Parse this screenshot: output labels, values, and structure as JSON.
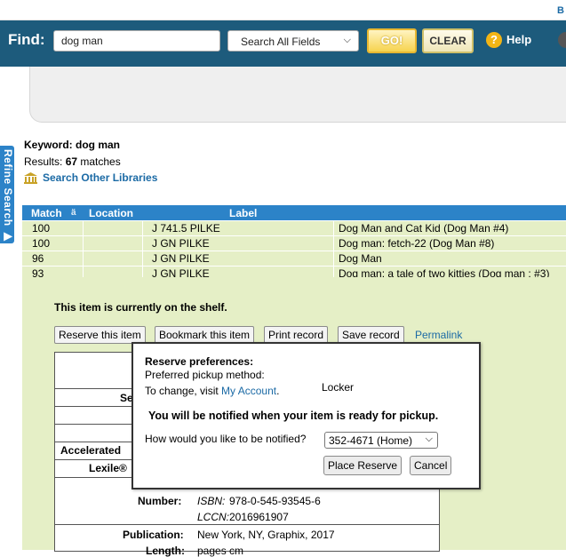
{
  "header": {
    "corner_letter": "B",
    "find_label": "Find:",
    "search_value": "dog man",
    "field_select": "Search All Fields",
    "go_label": "GO!",
    "clear_label": "CLEAR",
    "help_label": "Help"
  },
  "sidebar": {
    "refine_label": "Refine Search ▶"
  },
  "results": {
    "keyword_label": "Keyword: dog man",
    "results_prefix": "Results: ",
    "results_count": "67",
    "results_suffix": " matches",
    "other_libraries": "Search Other Libraries"
  },
  "table": {
    "columns": [
      "Match",
      "Location",
      "Label"
    ],
    "sort_indicator": "ä",
    "rows": [
      {
        "match": "100",
        "call": "J 741.5 PILKE",
        "title": "Dog Man and Cat Kid (Dog Man #4)"
      },
      {
        "match": "100",
        "call": "J GN PILKE",
        "title": "Dog man: fetch-22 (Dog Man #8)"
      },
      {
        "match": "96",
        "call": "J GN PILKE",
        "title": "Dog Man"
      },
      {
        "match": "93",
        "call": "J GN PILKE",
        "title": "Dog man: a tale of two kitties (Dog man ; #3)"
      }
    ]
  },
  "detail": {
    "status": "This item is currently on the shelf.",
    "buttons": [
      "Reserve this item",
      "Bookmark this item",
      "Print record",
      "Save record"
    ],
    "permalink": "Permalink",
    "partial_labels": {
      "se": "Se",
      "accelerated": "Accelerated",
      "lexile": "Lexile®"
    },
    "number_label": "Number:",
    "isbn_label": "ISBN:",
    "isbn_value": "978-0-545-93545-6",
    "lccn_label": "LCCN:",
    "lccn_value": "2016961907",
    "publication_label": "Publication:",
    "publication_value": "New York, NY, Graphix, 2017",
    "length_label": "Length:",
    "length_value": "pages cm"
  },
  "dialog": {
    "title": "Reserve preferences:",
    "pickup_label": "Preferred pickup method:",
    "change_prefix": "To change, visit ",
    "account_link": "My Account",
    "change_suffix": ".",
    "pickup_value": "Locker",
    "notice": "You will be notified when your item is ready for pickup.",
    "notify_question": "How would you like to be notified?",
    "notify_selected": "352-4671 (Home)",
    "place_label": "Place Reserve",
    "cancel_label": "Cancel"
  }
}
